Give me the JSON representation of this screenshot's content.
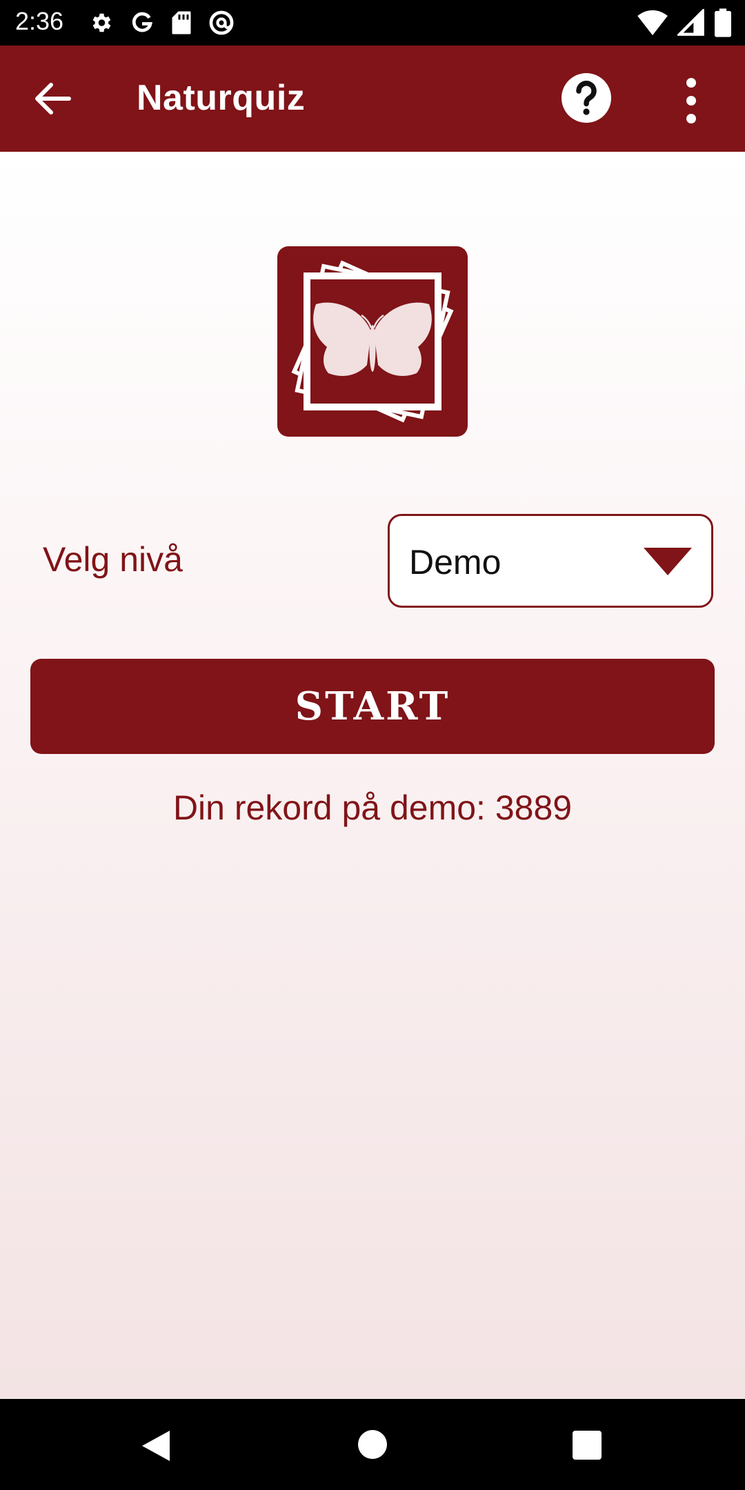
{
  "status_bar": {
    "time": "2:36",
    "left_icons": [
      "gear-icon",
      "google-g-icon",
      "sd-card-icon",
      "at-sign-icon"
    ],
    "right_icons": [
      "wifi-icon",
      "signal-icon",
      "battery-icon"
    ]
  },
  "app_bar": {
    "title": "Naturquiz",
    "back_icon": "arrow-left-icon",
    "help_icon": "help-circle-icon",
    "more_icon": "more-vert-icon",
    "color": "#801418"
  },
  "logo": {
    "icon": "butterfly-photo-stack-icon"
  },
  "level": {
    "label": "Velg nivå",
    "selected": "Demo"
  },
  "start_button": {
    "label": "START"
  },
  "record": {
    "text": "Din rekord på demo: 3889"
  },
  "nav_bar": {
    "buttons": [
      "back-triangle-icon",
      "home-circle-icon",
      "recents-square-icon"
    ]
  },
  "colors": {
    "primary": "#801418",
    "butterfly": "#f2dfe0"
  }
}
